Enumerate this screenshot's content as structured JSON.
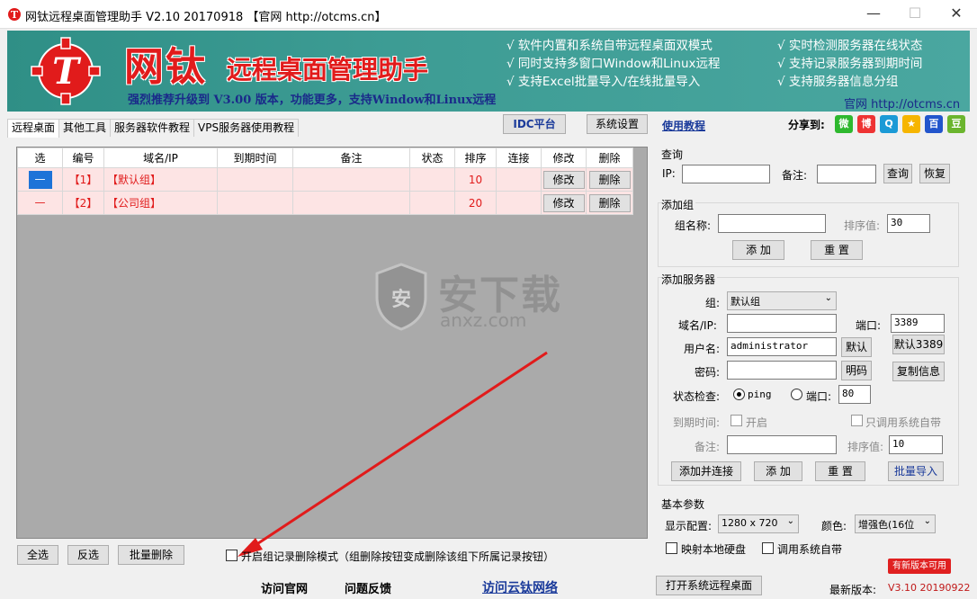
{
  "window": {
    "title": "网钛远程桌面管理助手 V2.10 20170918 【官网 http://otcms.cn】",
    "minimize": "—",
    "maximize": "☐",
    "close": "✕"
  },
  "banner": {
    "brand": "网钛",
    "brand_sub": "远程桌面管理助手",
    "slogan": "强烈推荐升级到 V3.00 版本，功能更多，支持Window和Linux远程",
    "features_left": [
      "√ 软件内置和系统自带远程桌面双模式",
      "√ 同时支持多窗口Window和Linux远程",
      "√ 支持Excel批量导入/在线批量导入"
    ],
    "features_right": [
      "√ 实时检测服务器在线状态",
      "√ 支持记录服务器到期时间",
      "√ 支持服务器信息分组"
    ],
    "site": "官网  http://otcms.cn"
  },
  "tabs": [
    "远程桌面",
    "其他工具",
    "服务器软件教程",
    "VPS服务器使用教程"
  ],
  "toolbar": {
    "idc": "IDC平台",
    "settings": "系统设置",
    "help": "使用教程",
    "share_label": "分享到:"
  },
  "table": {
    "headers": [
      "选",
      "编号",
      "域名/IP",
      "到期时间",
      "备注",
      "状态",
      "排序",
      "连接",
      "修改",
      "删除"
    ],
    "rows": [
      {
        "sel": "—",
        "id": "【1】",
        "name": "【默认组】",
        "expire": "",
        "note": "",
        "status": "",
        "sort": "10",
        "connect": "",
        "edit": "修改",
        "del": "删除"
      },
      {
        "sel": "—",
        "id": "【2】",
        "name": "【公司组】",
        "expire": "",
        "note": "",
        "status": "",
        "sort": "20",
        "connect": "",
        "edit": "修改",
        "del": "删除"
      }
    ]
  },
  "watermark": {
    "text": "安下载",
    "sub": "anxz.com"
  },
  "bottom": {
    "select_all": "全选",
    "invert": "反选",
    "batch_delete": "批量删除",
    "group_delete_mode": "开启组记录删除模式（组删除按钮变成删除该组下所属记录按钮）"
  },
  "query": {
    "title": "查询",
    "ip_label": "IP:",
    "note_label": "备注:",
    "search": "查询",
    "reset": "恢复"
  },
  "add_group": {
    "title": "添加组",
    "name_label": "组名称:",
    "sort_label": "排序值:",
    "sort_value": "30",
    "add": "添 加",
    "reset": "重 置"
  },
  "add_server": {
    "title": "添加服务器",
    "group_label": "组:",
    "group_value": "默认组",
    "host_label": "域名/IP:",
    "port_label": "端口:",
    "port_value": "3389",
    "user_label": "用户名:",
    "user_value": "administrator",
    "default_btn": "默认",
    "default3389_btn": "默认3389",
    "pwd_label": "密码:",
    "show_pwd_btn": "明码",
    "copy_btn": "复制信息",
    "check_label": "状态检查:",
    "ping_label": "ping",
    "port_check_label": "端口:",
    "port_check_value": "80",
    "expire_label": "到期时间:",
    "enable_label": "开启",
    "only_sys_label": "只调用系统自带",
    "note_label": "备注:",
    "sort_label": "排序值:",
    "sort_value": "10",
    "add_connect": "添加并连接",
    "add": "添 加",
    "reset": "重 置",
    "batch_import": "批量导入"
  },
  "basic": {
    "title": "基本参数",
    "display_label": "显示配置:",
    "display_value": "1280 x 720",
    "color_label": "颜色:",
    "color_value": "增强色(16位",
    "map_disk": "映射本地硬盘",
    "use_sys": "调用系统自带"
  },
  "footer": {
    "official": "访问官网",
    "feedback": "问题反馈",
    "cloud": "访问云钛网络",
    "open_rdp": "打开系统远程桌面",
    "latest_label": "最新版本:",
    "badge": "有新版本可用",
    "latest_value": "V3.10 20190922"
  },
  "colors": {
    "accent_red": "#e11b1b",
    "banner_teal": "#3d9c94",
    "select_blue": "#1e73d8",
    "row_pink": "#fde4e4"
  }
}
